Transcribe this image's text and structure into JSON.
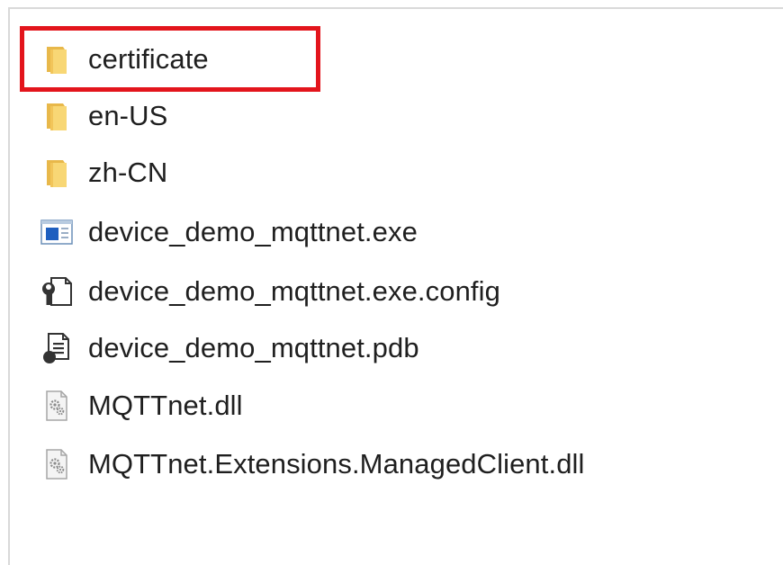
{
  "files": [
    {
      "name": "certificate",
      "icon": "folder-icon"
    },
    {
      "name": "en-US",
      "icon": "folder-icon"
    },
    {
      "name": "zh-CN",
      "icon": "folder-icon"
    },
    {
      "name": "device_demo_mqttnet.exe",
      "icon": "exe-app-icon"
    },
    {
      "name": "device_demo_mqttnet.exe.config",
      "icon": "config-file-icon"
    },
    {
      "name": "device_demo_mqttnet.pdb",
      "icon": "pdb-file-icon"
    },
    {
      "name": "MQTTnet.dll",
      "icon": "dll-file-icon"
    },
    {
      "name": "MQTTnet.Extensions.ManagedClient.dll",
      "icon": "dll-file-icon"
    }
  ],
  "highlighted_item": "certificate",
  "colors": {
    "highlight_border": "#e3151c",
    "folder_yellow": "#f8d775",
    "text": "#1f1f1f"
  }
}
